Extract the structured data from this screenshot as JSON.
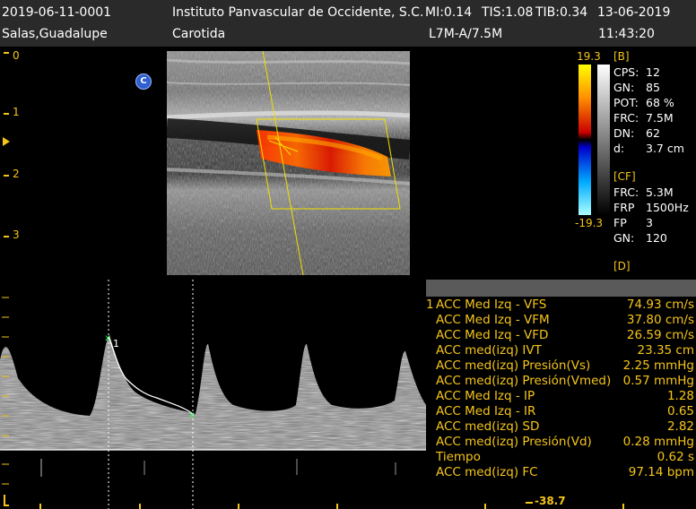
{
  "header": {
    "patient_id": "2019-06-11-0001",
    "patient_name": "Salas,Guadalupe",
    "institution": "Instituto Panvascular de Occidente, S.C.",
    "mi": "MI:0.14",
    "tis": "TIS:1.08",
    "tib": "TIB:0.34",
    "date": "13-06-2019",
    "exam": "Carotida",
    "probe": "L7M-A/7.5M",
    "time": "11:43:20"
  },
  "depth_scale": [
    "0",
    "1",
    "2",
    "3"
  ],
  "color_bar": {
    "max": "19.3",
    "min": "-19.3",
    "colors": [
      "#ffff00",
      "#ff8000",
      "#cc0000",
      "#000000",
      "#0000cc",
      "#00aaff",
      "#aaffff"
    ]
  },
  "markers": {
    "c_badge": "C",
    "trace_label": "1"
  },
  "b_params": {
    "title": "[B]",
    "rows": [
      {
        "k": "CPS:",
        "v": "12"
      },
      {
        "k": "GN:",
        "v": "85"
      },
      {
        "k": "POT:",
        "v": "68 %"
      },
      {
        "k": "FRC:",
        "v": "7.5M"
      },
      {
        "k": "DN:",
        "v": "62"
      },
      {
        "k": "d:",
        "v": "3.7 cm"
      }
    ]
  },
  "cf_params": {
    "title": "[CF]",
    "rows": [
      {
        "k": "FRC:",
        "v": "5.3M"
      },
      {
        "k": "FRP",
        "v": "1500Hz"
      },
      {
        "k": "FP",
        "v": "3"
      },
      {
        "k": "GN:",
        "v": "120"
      }
    ]
  },
  "d_params": {
    "title": "[D]"
  },
  "measurements": [
    {
      "index": "1",
      "label": "ACC  Med Izq - VFS",
      "value": "74.93 cm/s"
    },
    {
      "index": "",
      "label": "ACC Med Izq - VFM",
      "value": "37.80 cm/s"
    },
    {
      "index": "",
      "label": "ACC Med Izq - VFD",
      "value": "26.59 cm/s"
    },
    {
      "index": "",
      "label": "ACC med(izq) IVT",
      "value": "23.35 cm"
    },
    {
      "index": "",
      "label": "ACC med(izq) Presión(Vs)",
      "value": "2.25 mmHg"
    },
    {
      "index": "",
      "label": "ACC med(izq) Presión(Vmed)",
      "value": "0.57 mmHg"
    },
    {
      "index": "",
      "label": "ACC Med Izq - IP",
      "value": "1.28"
    },
    {
      "index": "",
      "label": "ACC Med Izq - IR",
      "value": "0.65"
    },
    {
      "index": "",
      "label": "ACC med(izq) SD",
      "value": "2.82"
    },
    {
      "index": "",
      "label": "ACC med(izq) Presión(Vd)",
      "value": "0.28 mmHg"
    },
    {
      "index": "",
      "label": "Tiempo",
      "value": "0.62 s"
    },
    {
      "index": "",
      "label": "ACC med(izq) FC",
      "value": "97.14 bpm"
    }
  ],
  "doppler_bottom_value": "-38.7"
}
